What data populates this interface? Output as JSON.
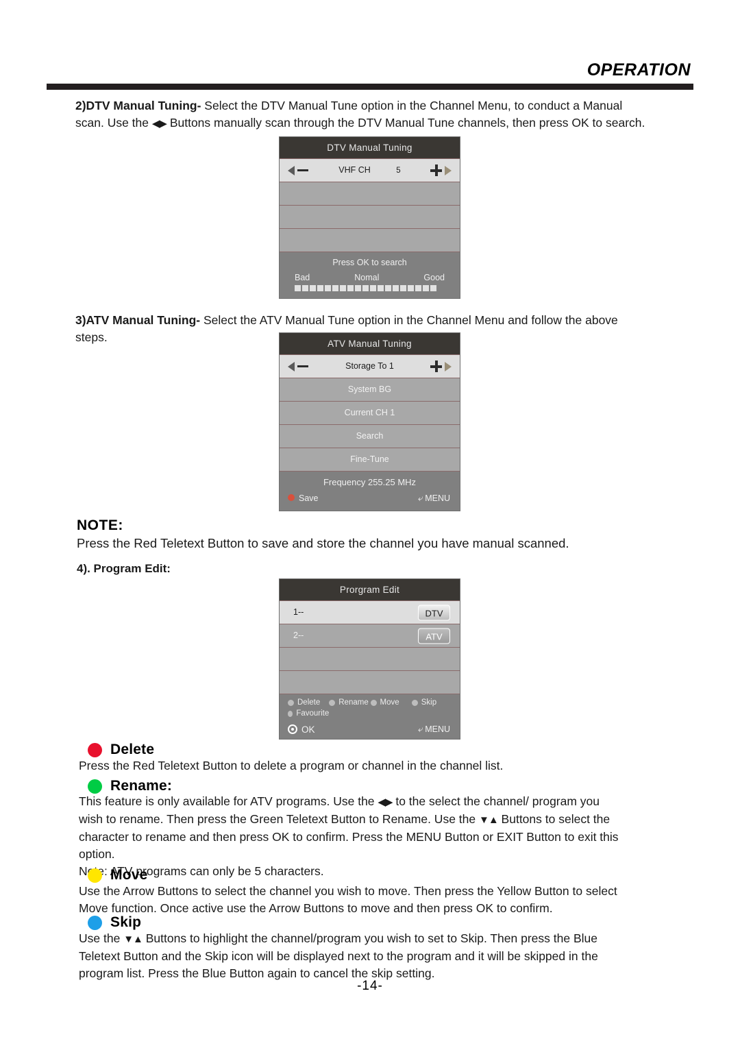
{
  "header": {
    "title": "OPERATION"
  },
  "sections": {
    "dtv_manual": {
      "heading": "2)DTV Manual Tuning",
      "dash": "-",
      "line1_a": " Select the DTV Manual Tune option in the Channel Menu, to conduct a Manual",
      "line2_a": "scan.  Use the ",
      "arrows": "◀▶",
      "line2_b": " Buttons manually scan through the DTV Manual Tune channels, then press OK  to search."
    },
    "atv_manual": {
      "heading": "3)ATV  Manual Tuning",
      "dash": "-",
      "line1_a": " Select the ATV Manual Tune option in the Channel Menu and follow the above",
      "line2": "steps."
    },
    "note": {
      "heading": "NOTE:",
      "body": "Press the Red Teletext Button to save and store the channel you have manual scanned."
    },
    "program_edit": {
      "heading": "4). Program Edit:"
    },
    "delete": {
      "label": "Delete",
      "color": "#e8112d",
      "body": "Press the Red Teletext Button to delete a program or channel in the channel list."
    },
    "rename": {
      "label": "Rename:",
      "color": "#00cc44",
      "body_l1_a": "This feature is only available for ATV programs. Use the ",
      "body_l1_arrows": "◀▶",
      "body_l1_b": " to the select the channel/ program you",
      "body_l2_a": "wish to rename. Then press the Green Teletext Button to Rename. Use the ",
      "body_l2_arrows": "▼▲",
      "body_l2_b": " Buttons to select the",
      "body_l3": "character to rename and then press OK to confirm. Press the MENU Button  or EXIT Button to exit this",
      "body_l4": "option.",
      "body_l5": "Note: ATV programs can only be 5 characters."
    },
    "move": {
      "label": "Move",
      "color": "#ffe600",
      "body_l1": "Use the Arrow Buttons to select the channel you wish to move. Then press the Yellow Button to select",
      "body_l2": "Move function. Once active use the Arrow Buttons to move and then press OK to confirm."
    },
    "skip": {
      "label": "Skip",
      "color": "#1e9fe8",
      "body_l1_a": "Use the ",
      "body_l1_arrows": "▼▲",
      "body_l1_b": " Buttons to highlight the channel/program you wish to set to Skip. Then press the Blue",
      "body_l2": "Teletext Button and the Skip icon will be displayed next to the program and it will be skipped in the",
      "body_l3": "program list. Press the Blue Button again to cancel the skip setting."
    }
  },
  "osd_dtv": {
    "title": "DTV Manual Tuning",
    "tune_row": {
      "label": "VHF CH",
      "value": "5"
    },
    "blank_rows": [
      "",
      "",
      ""
    ],
    "footer": {
      "prompt": "Press OK to search",
      "scale_low": "Bad",
      "scale_mid": "Nomal",
      "scale_high": "Good",
      "segments": 19
    }
  },
  "osd_atv": {
    "title": "ATV Manual Tuning",
    "storage_row": "Storage To 1",
    "rows": [
      "System BG",
      "Current CH 1",
      "Search",
      "Fine-Tune"
    ],
    "footer": {
      "frequency": "Frequency  255.25  MHz",
      "save_label": "Save",
      "menu_label": "MENU"
    }
  },
  "osd_program_edit": {
    "title": "Prorgram Edit",
    "rows": [
      {
        "label": "1--",
        "badge": "DTV",
        "selected": true
      },
      {
        "label": "2--",
        "badge": "ATV",
        "selected": false
      },
      {
        "label": "",
        "badge": "",
        "selected": false
      },
      {
        "label": "",
        "badge": "",
        "selected": false
      }
    ],
    "color_keys": [
      "Delete",
      "Rename",
      "Move",
      "Skip",
      "Favourite"
    ],
    "footer": {
      "ok_label": "OK",
      "menu_label": "MENU"
    }
  },
  "footer": {
    "page_number": "-14-"
  }
}
